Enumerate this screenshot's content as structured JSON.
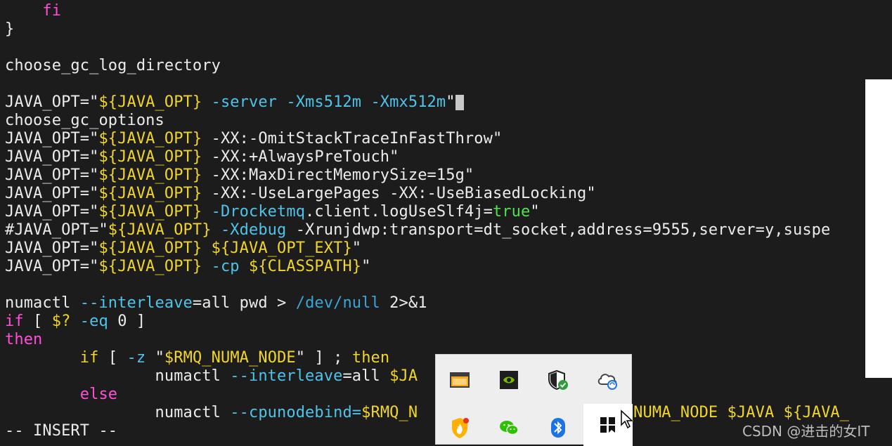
{
  "terminal": {
    "lines": [
      {
        "segments": [
          {
            "t": "    ",
            "c": "str"
          },
          {
            "t": "fi",
            "c": "kw"
          }
        ]
      },
      {
        "segments": [
          {
            "t": "}",
            "c": "str"
          }
        ]
      },
      {
        "segments": []
      },
      {
        "segments": [
          {
            "t": "choose_gc_log_directory",
            "c": "str"
          }
        ]
      },
      {
        "segments": []
      },
      {
        "segments": [
          {
            "t": "JAVA_OPT=\"",
            "c": "str"
          },
          {
            "t": "${JAVA_OPT}",
            "c": "var"
          },
          {
            "t": " -server -Xms512m -Xmx512m",
            "c": "opt"
          },
          {
            "t": "\"",
            "c": "str"
          }
        ],
        "cursor": true
      },
      {
        "segments": [
          {
            "t": "choose_gc_options",
            "c": "str"
          }
        ]
      },
      {
        "segments": [
          {
            "t": "JAVA_OPT=\"",
            "c": "str"
          },
          {
            "t": "${JAVA_OPT}",
            "c": "var"
          },
          {
            "t": " -XX:-OmitStackTraceInFastThrow\"",
            "c": "str"
          }
        ]
      },
      {
        "segments": [
          {
            "t": "JAVA_OPT=\"",
            "c": "str"
          },
          {
            "t": "${JAVA_OPT}",
            "c": "var"
          },
          {
            "t": " -XX:+AlwaysPreTouch\"",
            "c": "str"
          }
        ]
      },
      {
        "segments": [
          {
            "t": "JAVA_OPT=\"",
            "c": "str"
          },
          {
            "t": "${JAVA_OPT}",
            "c": "var"
          },
          {
            "t": " -XX:MaxDirectMemorySize=15g\"",
            "c": "str"
          }
        ]
      },
      {
        "segments": [
          {
            "t": "JAVA_OPT=\"",
            "c": "str"
          },
          {
            "t": "${JAVA_OPT}",
            "c": "var"
          },
          {
            "t": " -XX:-UseLargePages -XX:-UseBiasedLocking\"",
            "c": "str"
          }
        ]
      },
      {
        "segments": [
          {
            "t": "JAVA_OPT=\"",
            "c": "str"
          },
          {
            "t": "${JAVA_OPT}",
            "c": "var"
          },
          {
            "t": " -Drocketmq",
            "c": "opt"
          },
          {
            "t": ".client.logUseSlf4j=",
            "c": "str"
          },
          {
            "t": "true",
            "c": "grn"
          },
          {
            "t": "\"",
            "c": "str"
          }
        ]
      },
      {
        "segments": [
          {
            "t": "#JAVA_OPT=\"",
            "c": "str"
          },
          {
            "t": "${JAVA_OPT}",
            "c": "var"
          },
          {
            "t": " -Xdebug",
            "c": "opt"
          },
          {
            "t": " -Xrunjdwp:transport=dt_socket,address=9555,server=y,suspe",
            "c": "str"
          }
        ]
      },
      {
        "segments": [
          {
            "t": "JAVA_OPT=\"",
            "c": "str"
          },
          {
            "t": "${JAVA_OPT}",
            "c": "var"
          },
          {
            "t": " ",
            "c": "str"
          },
          {
            "t": "${JAVA_OPT_EXT}",
            "c": "var"
          },
          {
            "t": "\"",
            "c": "str"
          }
        ]
      },
      {
        "segments": [
          {
            "t": "JAVA_OPT=\"",
            "c": "str"
          },
          {
            "t": "${JAVA_OPT}",
            "c": "var"
          },
          {
            "t": " -cp ",
            "c": "opt"
          },
          {
            "t": "${CLASSPATH}",
            "c": "var"
          },
          {
            "t": "\"",
            "c": "str"
          }
        ]
      },
      {
        "segments": []
      },
      {
        "segments": [
          {
            "t": "numactl ",
            "c": "str"
          },
          {
            "t": "--interleave",
            "c": "opt"
          },
          {
            "t": "=all pwd > ",
            "c": "str"
          },
          {
            "t": "/dev/null",
            "c": "path"
          },
          {
            "t": " 2>&1",
            "c": "str"
          }
        ]
      },
      {
        "segments": [
          {
            "t": "if",
            "c": "kw"
          },
          {
            "t": " [ ",
            "c": "str"
          },
          {
            "t": "$?",
            "c": "var"
          },
          {
            "t": " -eq",
            "c": "opt"
          },
          {
            "t": " 0 ]",
            "c": "str"
          }
        ]
      },
      {
        "segments": [
          {
            "t": "then",
            "c": "kw"
          }
        ]
      },
      {
        "segments": [
          {
            "t": "        ",
            "c": "str"
          },
          {
            "t": "if",
            "c": "var"
          },
          {
            "t": " [ ",
            "c": "str"
          },
          {
            "t": "-z",
            "c": "opt"
          },
          {
            "t": " \"",
            "c": "str"
          },
          {
            "t": "$RMQ_NUMA_NODE",
            "c": "var"
          },
          {
            "t": "\" ] ; ",
            "c": "str"
          },
          {
            "t": "then",
            "c": "var"
          }
        ]
      },
      {
        "segments": [
          {
            "t": "                numactl ",
            "c": "str"
          },
          {
            "t": "--interleave",
            "c": "opt"
          },
          {
            "t": "=all ",
            "c": "str"
          },
          {
            "t": "$JA",
            "c": "var"
          }
        ]
      },
      {
        "segments": [
          {
            "t": "        ",
            "c": "str"
          },
          {
            "t": "else",
            "c": "kw"
          }
        ]
      },
      {
        "segments": [
          {
            "t": "                numactl ",
            "c": "str"
          },
          {
            "t": "--cpunodebind=",
            "c": "opt"
          },
          {
            "t": "$RMQ_N",
            "c": "var"
          },
          {
            "t": "                   ",
            "c": "str"
          },
          {
            "t": "RMQ_NUMA_NODE $JAVA ${JAVA_",
            "c": "var"
          }
        ]
      },
      {
        "segments": [
          {
            "t": "-- INSERT --",
            "c": "str"
          }
        ]
      }
    ]
  },
  "tray": {
    "icons": [
      {
        "name": "window-app-icon"
      },
      {
        "name": "nvidia-icon"
      },
      {
        "name": "windows-security-icon"
      },
      {
        "name": "onedrive-sync-icon"
      },
      {
        "name": "huorong-security-icon"
      },
      {
        "name": "wechat-icon"
      },
      {
        "name": "bluetooth-icon"
      },
      {
        "name": "app-black-icon"
      }
    ],
    "colors": {
      "nvidia": "#76b900",
      "bluetooth": "#1a73e8",
      "wechat": "#2dc100",
      "shield_check": "#2e9d3a",
      "fire": "#ff6a00"
    }
  },
  "watermark": "CSDN @进击的女IT"
}
